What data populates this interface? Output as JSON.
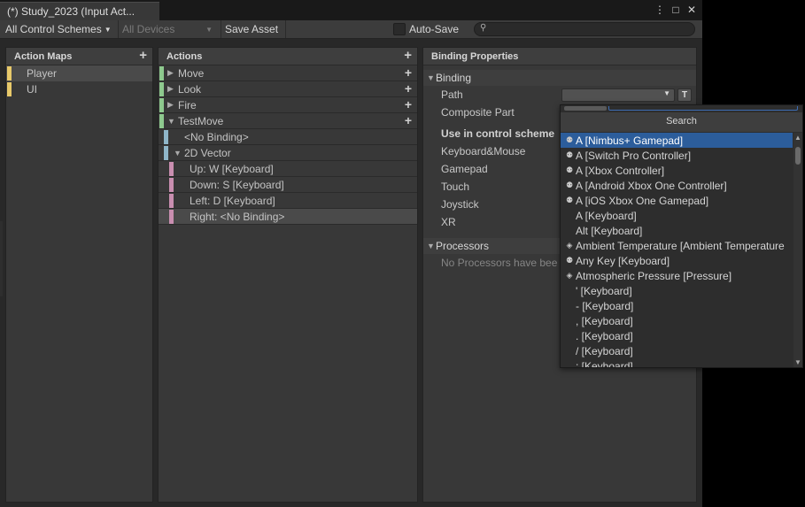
{
  "window": {
    "tab_title": "(*) Study_2023 (Input Act...",
    "controls": {
      "menu": "⋮",
      "maximize": "□",
      "close": "✕"
    }
  },
  "toolbar": {
    "control_schemes": "All Control Schemes",
    "devices": "All Devices",
    "save_asset": "Save Asset",
    "auto_save": "Auto-Save",
    "search_placeholder": ""
  },
  "action_maps": {
    "header": "Action Maps",
    "items": [
      {
        "label": "Player",
        "selected": true,
        "color": "#e8c96a"
      },
      {
        "label": "UI",
        "selected": false,
        "color": "#e8c96a"
      }
    ]
  },
  "actions": {
    "header": "Actions",
    "items": [
      {
        "label": "Move"
      },
      {
        "label": "Look"
      },
      {
        "label": "Fire"
      },
      {
        "label": "TestMove"
      }
    ],
    "bindings": [
      {
        "label": "<No Binding>"
      },
      {
        "label": "2D Vector"
      },
      {
        "label": "Up: W [Keyboard]"
      },
      {
        "label": "Down: S [Keyboard]"
      },
      {
        "label": "Left: D [Keyboard]"
      },
      {
        "label": "Right: <No Binding>"
      }
    ]
  },
  "binding_properties": {
    "header": "Binding Properties",
    "binding_section": "Binding",
    "path_label": "Path",
    "t_button": "T",
    "composite_part_label": "Composite Part",
    "use_in_control_scheme": "Use in control scheme",
    "schemes": [
      "Keyboard&Mouse",
      "Gamepad",
      "Touch",
      "Joystick",
      "XR"
    ],
    "processors_section": "Processors",
    "processors_empty": "No Processors have bee"
  },
  "popup": {
    "title": "Search",
    "items": [
      {
        "label": "A [Nimbus+ Gamepad]",
        "icon": "gamepad-icon",
        "highlighted": true
      },
      {
        "label": "A [Switch Pro Controller]",
        "icon": "gamepad-icon"
      },
      {
        "label": "A [Xbox Controller]",
        "icon": "gamepad-icon"
      },
      {
        "label": "A [Android Xbox One Controller]",
        "icon": "gamepad-icon"
      },
      {
        "label": "A [iOS Xbox One Gamepad]",
        "icon": "gamepad-icon"
      },
      {
        "label": "A [Keyboard]",
        "icon": ""
      },
      {
        "label": "Alt [Keyboard]",
        "icon": ""
      },
      {
        "label": "Ambient Temperature [Ambient Temperature",
        "icon": "sensor-icon"
      },
      {
        "label": "Any Key [Keyboard]",
        "icon": "gamepad-icon"
      },
      {
        "label": "Atmospheric Pressure [Pressure]",
        "icon": "sensor-icon"
      },
      {
        "label": "' [Keyboard]",
        "icon": ""
      },
      {
        "label": "- [Keyboard]",
        "icon": ""
      },
      {
        "label": ", [Keyboard]",
        "icon": ""
      },
      {
        "label": ". [Keyboard]",
        "icon": ""
      },
      {
        "label": "/ [Keyboard]",
        "icon": ""
      },
      {
        "label": "; [Keyboard]",
        "icon": ""
      }
    ]
  },
  "colors": {
    "action_bar": "#8ec98e",
    "binding_bar": "#8fb6c9",
    "composite_bar": "#c98eb0",
    "highlight": "#2c5d9b"
  }
}
